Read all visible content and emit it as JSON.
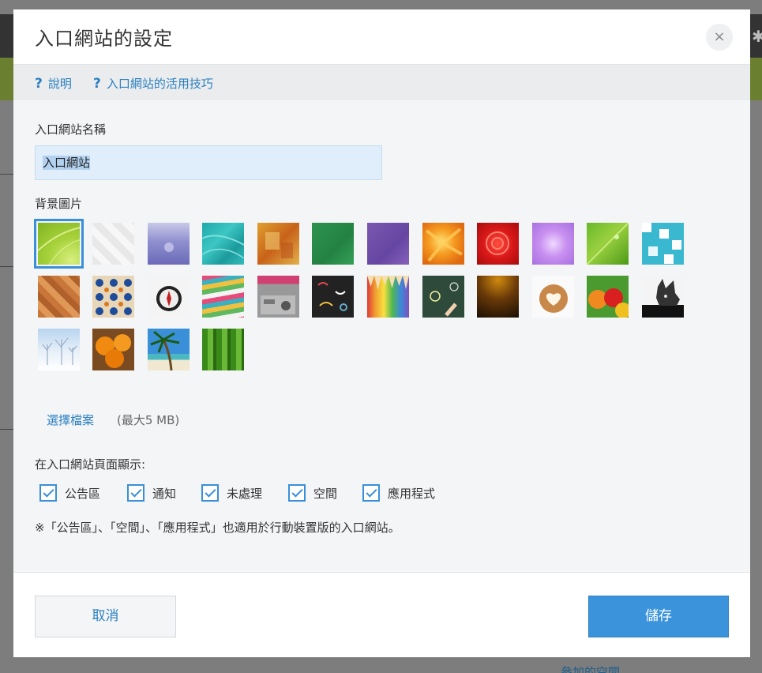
{
  "modal": {
    "title": "入口網站的設定",
    "close_icon": "×"
  },
  "help": {
    "items": [
      {
        "icon": "?",
        "label": "說明"
      },
      {
        "icon": "?",
        "label": "入口網站的活用技巧"
      }
    ]
  },
  "form": {
    "name_label": "入口網站名稱",
    "name_value": "入口網站",
    "background_label": "背景圖片",
    "background_selected_index": 0,
    "backgrounds": [
      "green-arc",
      "white-diamonds",
      "lavender-blur",
      "teal-ripple",
      "orange-grunge",
      "green-fabric",
      "purple-fabric",
      "orange-lily",
      "red-carnation",
      "purple-orchid",
      "green-leaf",
      "teal-blocks",
      "wood-herringbone",
      "moroccan-tiles",
      "compass",
      "colored-books",
      "office-desk",
      "chalk-doodles",
      "colored-pencils",
      "lightbulb-chalkboard",
      "dark-amber",
      "latte-art",
      "peppers",
      "french-bulldog",
      "snowy-trees",
      "pumpkins",
      "palm-beach",
      "bamboo"
    ],
    "choose_file": "選擇檔案",
    "max_size": "(最大5 MB)",
    "display_label": "在入口網站頁面顯示:",
    "checkboxes": [
      {
        "label": "公告區",
        "checked": true
      },
      {
        "label": "通知",
        "checked": true
      },
      {
        "label": "未處理",
        "checked": true
      },
      {
        "label": "空間",
        "checked": true
      },
      {
        "label": "應用程式",
        "checked": true
      }
    ],
    "note": "※「公告區」、「空間」、「應用程式」也適用於行動裝置版的入口網站。"
  },
  "footer": {
    "cancel_label": "取消",
    "save_label": "儲存"
  },
  "background_app": {
    "bottom_link": "參加的空間"
  }
}
